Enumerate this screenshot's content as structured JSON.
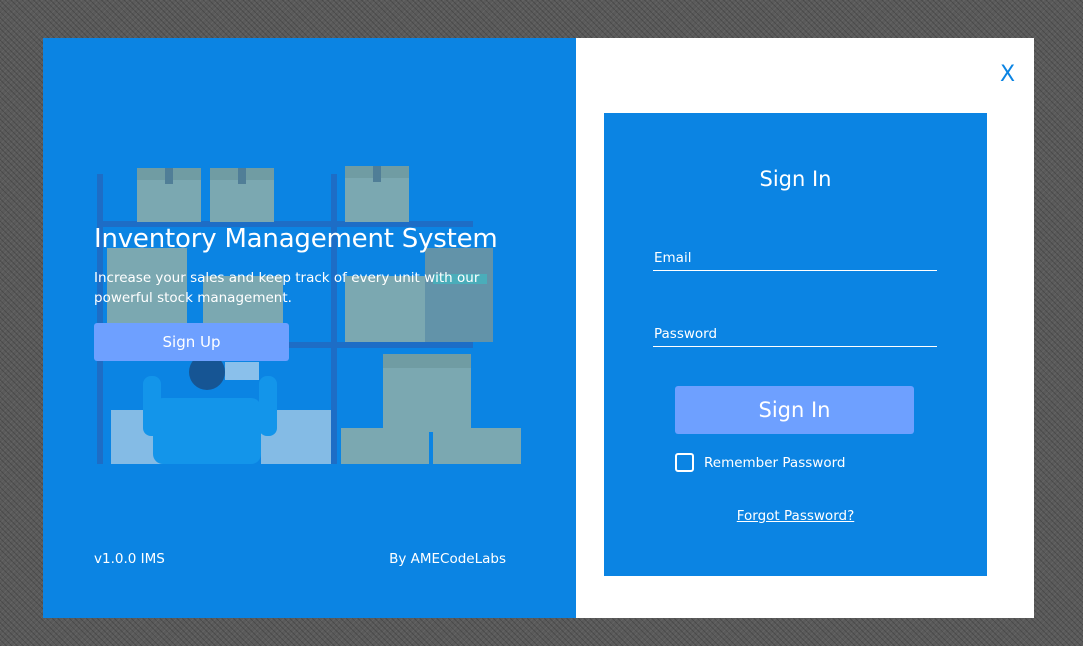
{
  "window": {
    "close_label": "X"
  },
  "left_panel": {
    "title": "Inventory Management System",
    "subtitle": "Increase your sales and keep track of every unit with our powerful stock management.",
    "signup_label": "Sign Up",
    "version": "v1.0.0 IMS",
    "author": "By AMECodeLabs"
  },
  "signin": {
    "title": "Sign In",
    "email_placeholder": "Email",
    "password_placeholder": "Password",
    "button_label": "Sign In",
    "remember_label": "Remember Password",
    "remember_checked": false,
    "forgot_label": "Forgot Password?"
  },
  "colors": {
    "primary_blue": "#0b84e3",
    "button_blue": "#6ea0ff",
    "white": "#ffffff"
  }
}
